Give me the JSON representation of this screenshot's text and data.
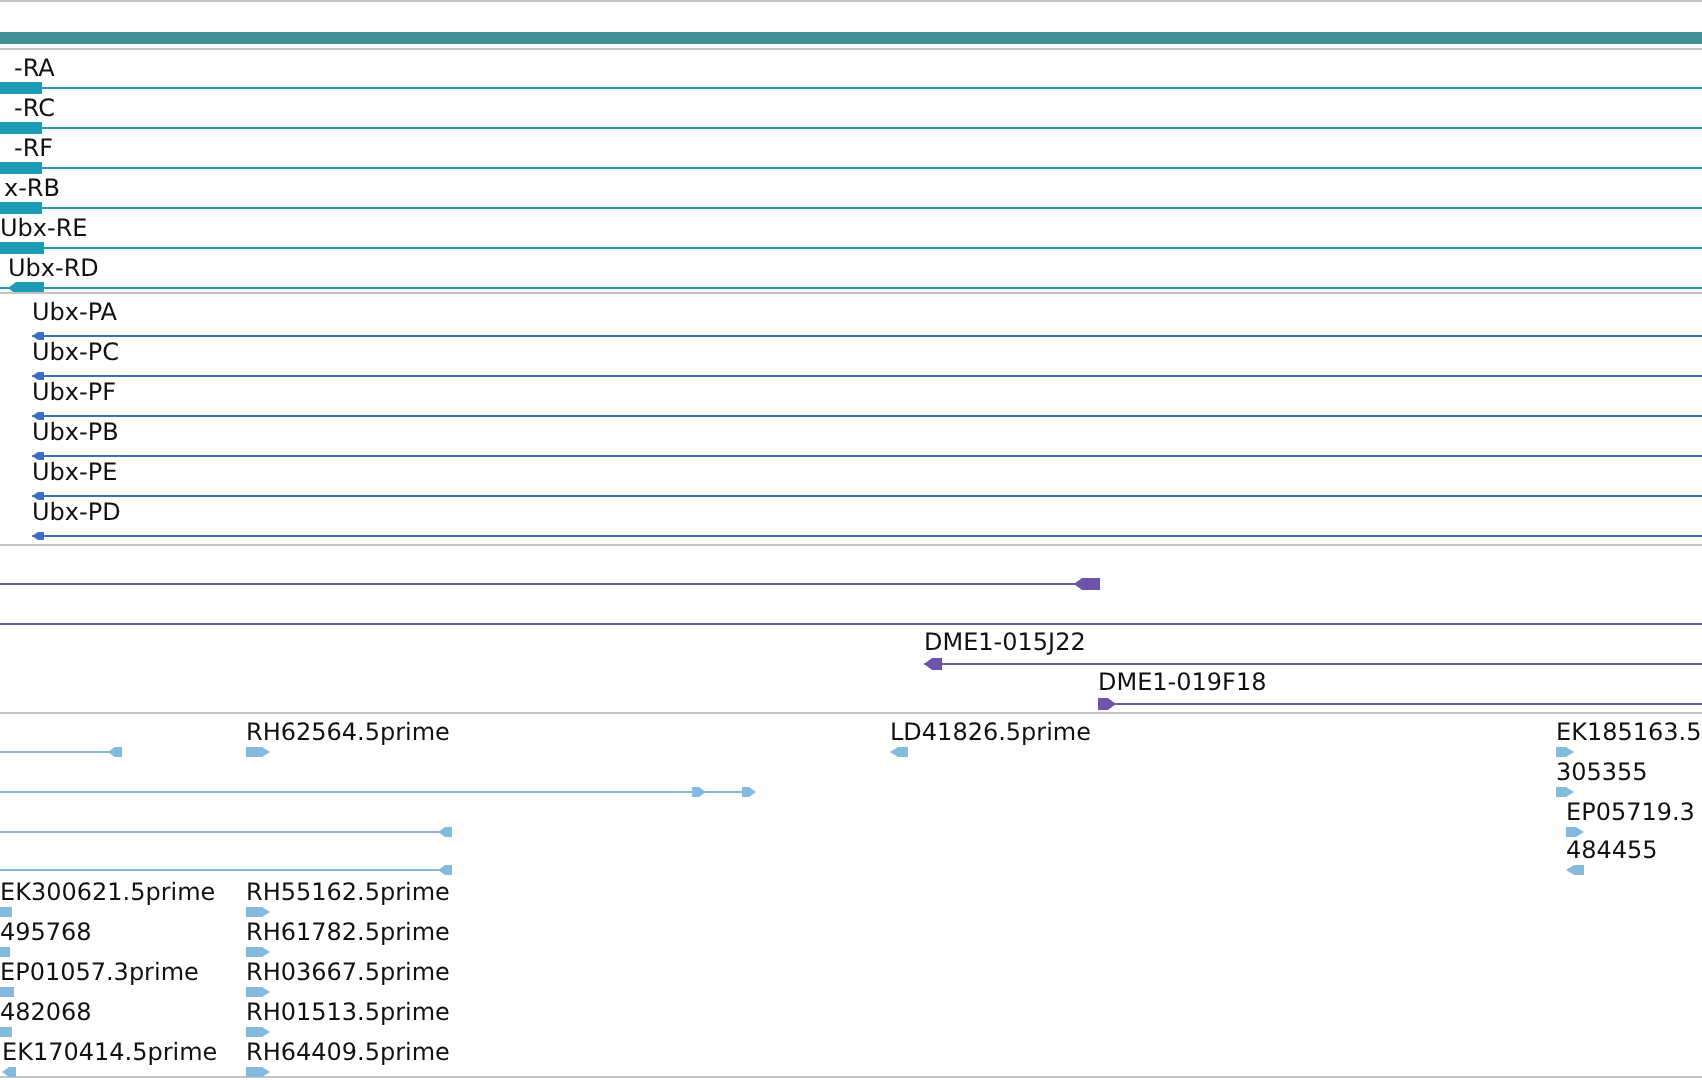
{
  "tracks": [
    {
      "kind": "summary",
      "color": "#3f8f94"
    },
    {
      "kind": "transcripts",
      "color": "#1c9cb6",
      "features": [
        {
          "label": "-RA",
          "reverse": true
        },
        {
          "label": "-RC",
          "reverse": true
        },
        {
          "label": "-RF",
          "reverse": true
        },
        {
          "label": "x-RB",
          "reverse": true
        },
        {
          "label": "Ubx-RE",
          "reverse": true
        },
        {
          "label": "Ubx-RD",
          "reverse": true
        }
      ]
    },
    {
      "kind": "proteins",
      "color": "#3a6fc4",
      "features": [
        {
          "label": "Ubx-PA",
          "reverse": true
        },
        {
          "label": "Ubx-PC",
          "reverse": true
        },
        {
          "label": "Ubx-PF",
          "reverse": true
        },
        {
          "label": "Ubx-PB",
          "reverse": true
        },
        {
          "label": "Ubx-PE",
          "reverse": true
        },
        {
          "label": "Ubx-PD",
          "reverse": true
        }
      ]
    },
    {
      "kind": "clones",
      "color": "#6f55aa",
      "features": [
        {
          "kind": "arrow",
          "reverse": true
        },
        {
          "kind": "line"
        },
        {
          "kind": "arrow",
          "label": "DME1-015J22",
          "reverse": true
        },
        {
          "kind": "arrow",
          "label": "DME1-019F18",
          "reverse": false
        }
      ]
    },
    {
      "kind": "ests",
      "color": "#85badf",
      "features": [
        {
          "reverse": true
        },
        {
          "label": "RH62564.5prime",
          "reverse": false
        },
        {
          "label": "LD41826.5prime",
          "reverse": true
        },
        {
          "label": "EK185163.5",
          "reverse": false
        },
        {
          "reverse": false
        },
        {
          "label": "305355",
          "reverse": false
        },
        {
          "reverse": true
        },
        {
          "label": "EP05719.3",
          "reverse": false
        },
        {
          "reverse": true
        },
        {
          "label": "484455",
          "reverse": true
        },
        {
          "label": "EK300621.5prime",
          "reverse": true
        },
        {
          "label": "RH55162.5prime",
          "reverse": false
        },
        {
          "label": "495768",
          "reverse": true
        },
        {
          "label": "RH61782.5prime",
          "reverse": false
        },
        {
          "label": "EP01057.3prime",
          "reverse": true
        },
        {
          "label": "RH03667.5prime",
          "reverse": false
        },
        {
          "label": "482068",
          "reverse": true
        },
        {
          "label": "RH01513.5prime",
          "reverse": false
        },
        {
          "label": "EK170414.5prime",
          "reverse": true
        },
        {
          "label": "RH64409.5prime",
          "reverse": false
        }
      ]
    }
  ]
}
